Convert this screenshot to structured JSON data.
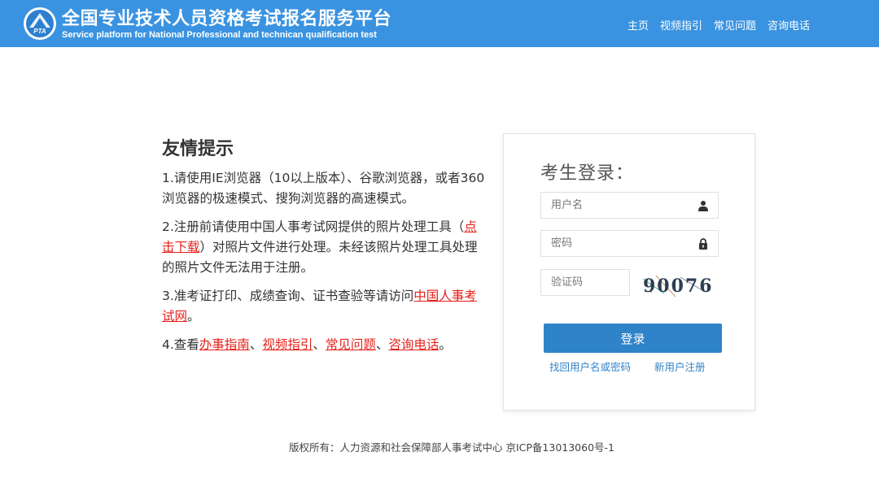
{
  "header": {
    "title": "全国专业技术人员资格考试报名服务平台",
    "subtitle": "Service platform for National Professional and technican qualification test",
    "logo_text": "PTA",
    "nav": [
      "主页",
      "视频指引",
      "常见问题",
      "咨询电话"
    ]
  },
  "tips": {
    "title": "友情提示",
    "tip1": "1.请使用IE浏览器（10以上版本）、谷歌浏览器，或者360浏览器的极速模式、搜狗浏览器的高速模式。",
    "tip2_a": "2.注册前请使用中国人事考试网提供的照片处理工具",
    "tip2_paren_open": "（",
    "tip2_link": "点击下载",
    "tip2_paren_close": "）",
    "tip2_b": "对照片文件进行处理。未经该照片处理工具处理的照片文件无法用于注册。",
    "tip3_a": "3.准考证打印、成绩查询、证书查验等请访问",
    "tip3_link": "中国人事考试网",
    "tip3_b": "。",
    "tip4_a": "4.查看",
    "tip4_links": [
      "办事指南",
      "视频指引",
      "常见问题",
      "咨询电话"
    ],
    "tip4_sep": "、",
    "tip4_end": "。"
  },
  "login": {
    "title": "考生登录：",
    "username_placeholder": "用户名",
    "password_placeholder": "密码",
    "captcha_placeholder": "验证码",
    "captcha_text": "90076",
    "submit_label": "登录",
    "recover_label": "找回用户名或密码",
    "register_label": "新用户注册"
  },
  "footer": {
    "text": "版权所有：人力资源和社会保障部人事考试中心 京ICP备13013060号-1"
  },
  "colors": {
    "header_bg": "#3a93e0",
    "accent": "#2f83c8",
    "link_red": "#e8201a"
  }
}
